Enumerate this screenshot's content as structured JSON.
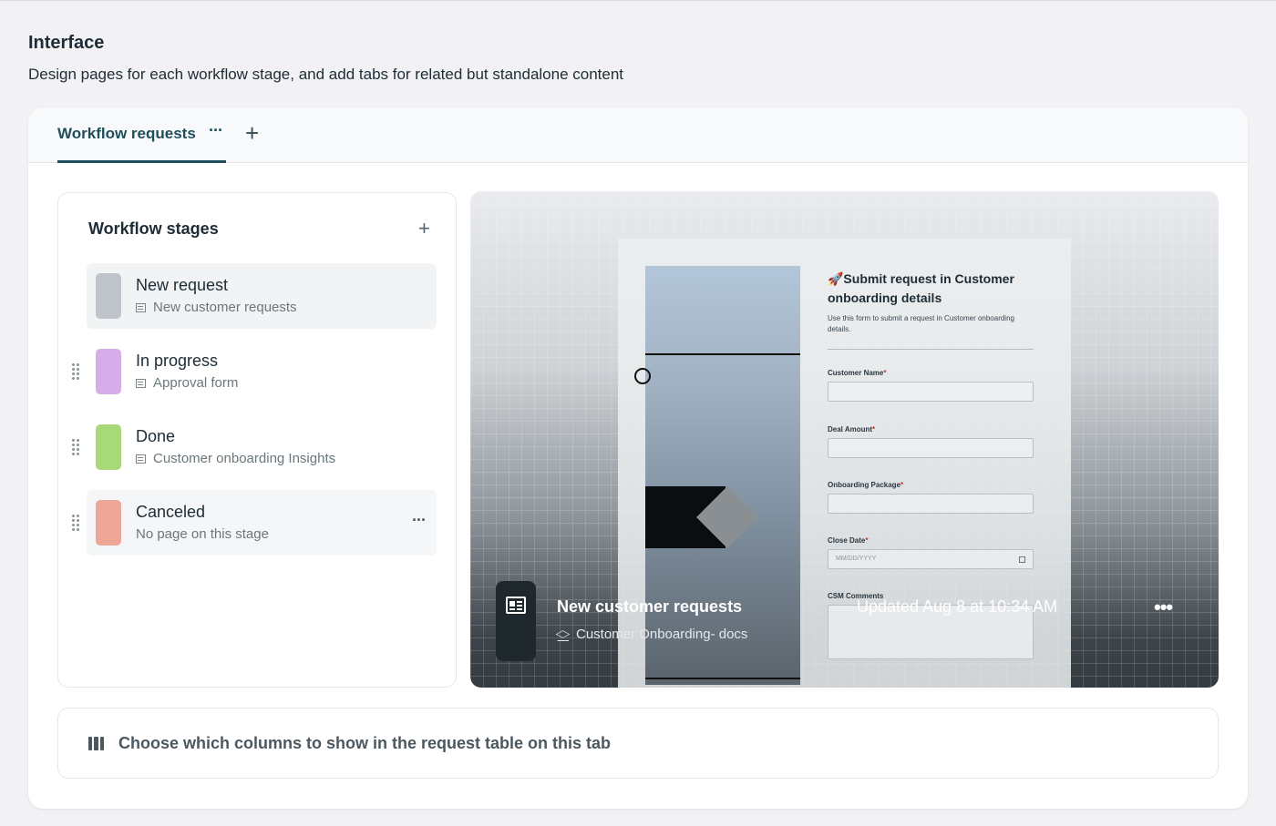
{
  "section": {
    "title": "Interface",
    "description": "Design pages for each workflow stage, and add tabs for related but standalone content"
  },
  "tabs": [
    {
      "label": "Workflow requests",
      "more": "···",
      "active": true
    }
  ],
  "tab_add": "+",
  "stages": {
    "title": "Workflow stages",
    "add": "+",
    "items": [
      {
        "name": "New request",
        "page": "New customer requests",
        "color": "#bfc4ca",
        "selected": true
      },
      {
        "name": "In progress",
        "page": "Approval form",
        "color": "#d5aee9"
      },
      {
        "name": "Done",
        "page": "Customer onboarding Insights",
        "color": "#a8d978"
      },
      {
        "name": "Canceled",
        "page": "No page on this stage",
        "color": "#eea796",
        "more": "···"
      }
    ]
  },
  "preview": {
    "form": {
      "title": "🚀Submit request in Customer onboarding details",
      "description": "Use this form to submit a request in Customer onboarding details.",
      "fields": [
        {
          "label": "Customer Name",
          "required": "*"
        },
        {
          "label": "Deal Amount",
          "required": "*"
        },
        {
          "label": "Onboarding Package",
          "required": "*"
        },
        {
          "label": "Close Date",
          "required": "*",
          "placeholder": "MM/DD/YYYY"
        },
        {
          "label": "CSM Comments"
        }
      ]
    },
    "title": "New customer requests",
    "source": "Customer Onboarding- docs",
    "updated": "Updated Aug 8 at 10:34 AM",
    "more": "•••",
    "icon": "page-layout-icon"
  },
  "columns": {
    "label": "Choose which columns to show in the request table on this tab",
    "icon": "columns-icon"
  }
}
